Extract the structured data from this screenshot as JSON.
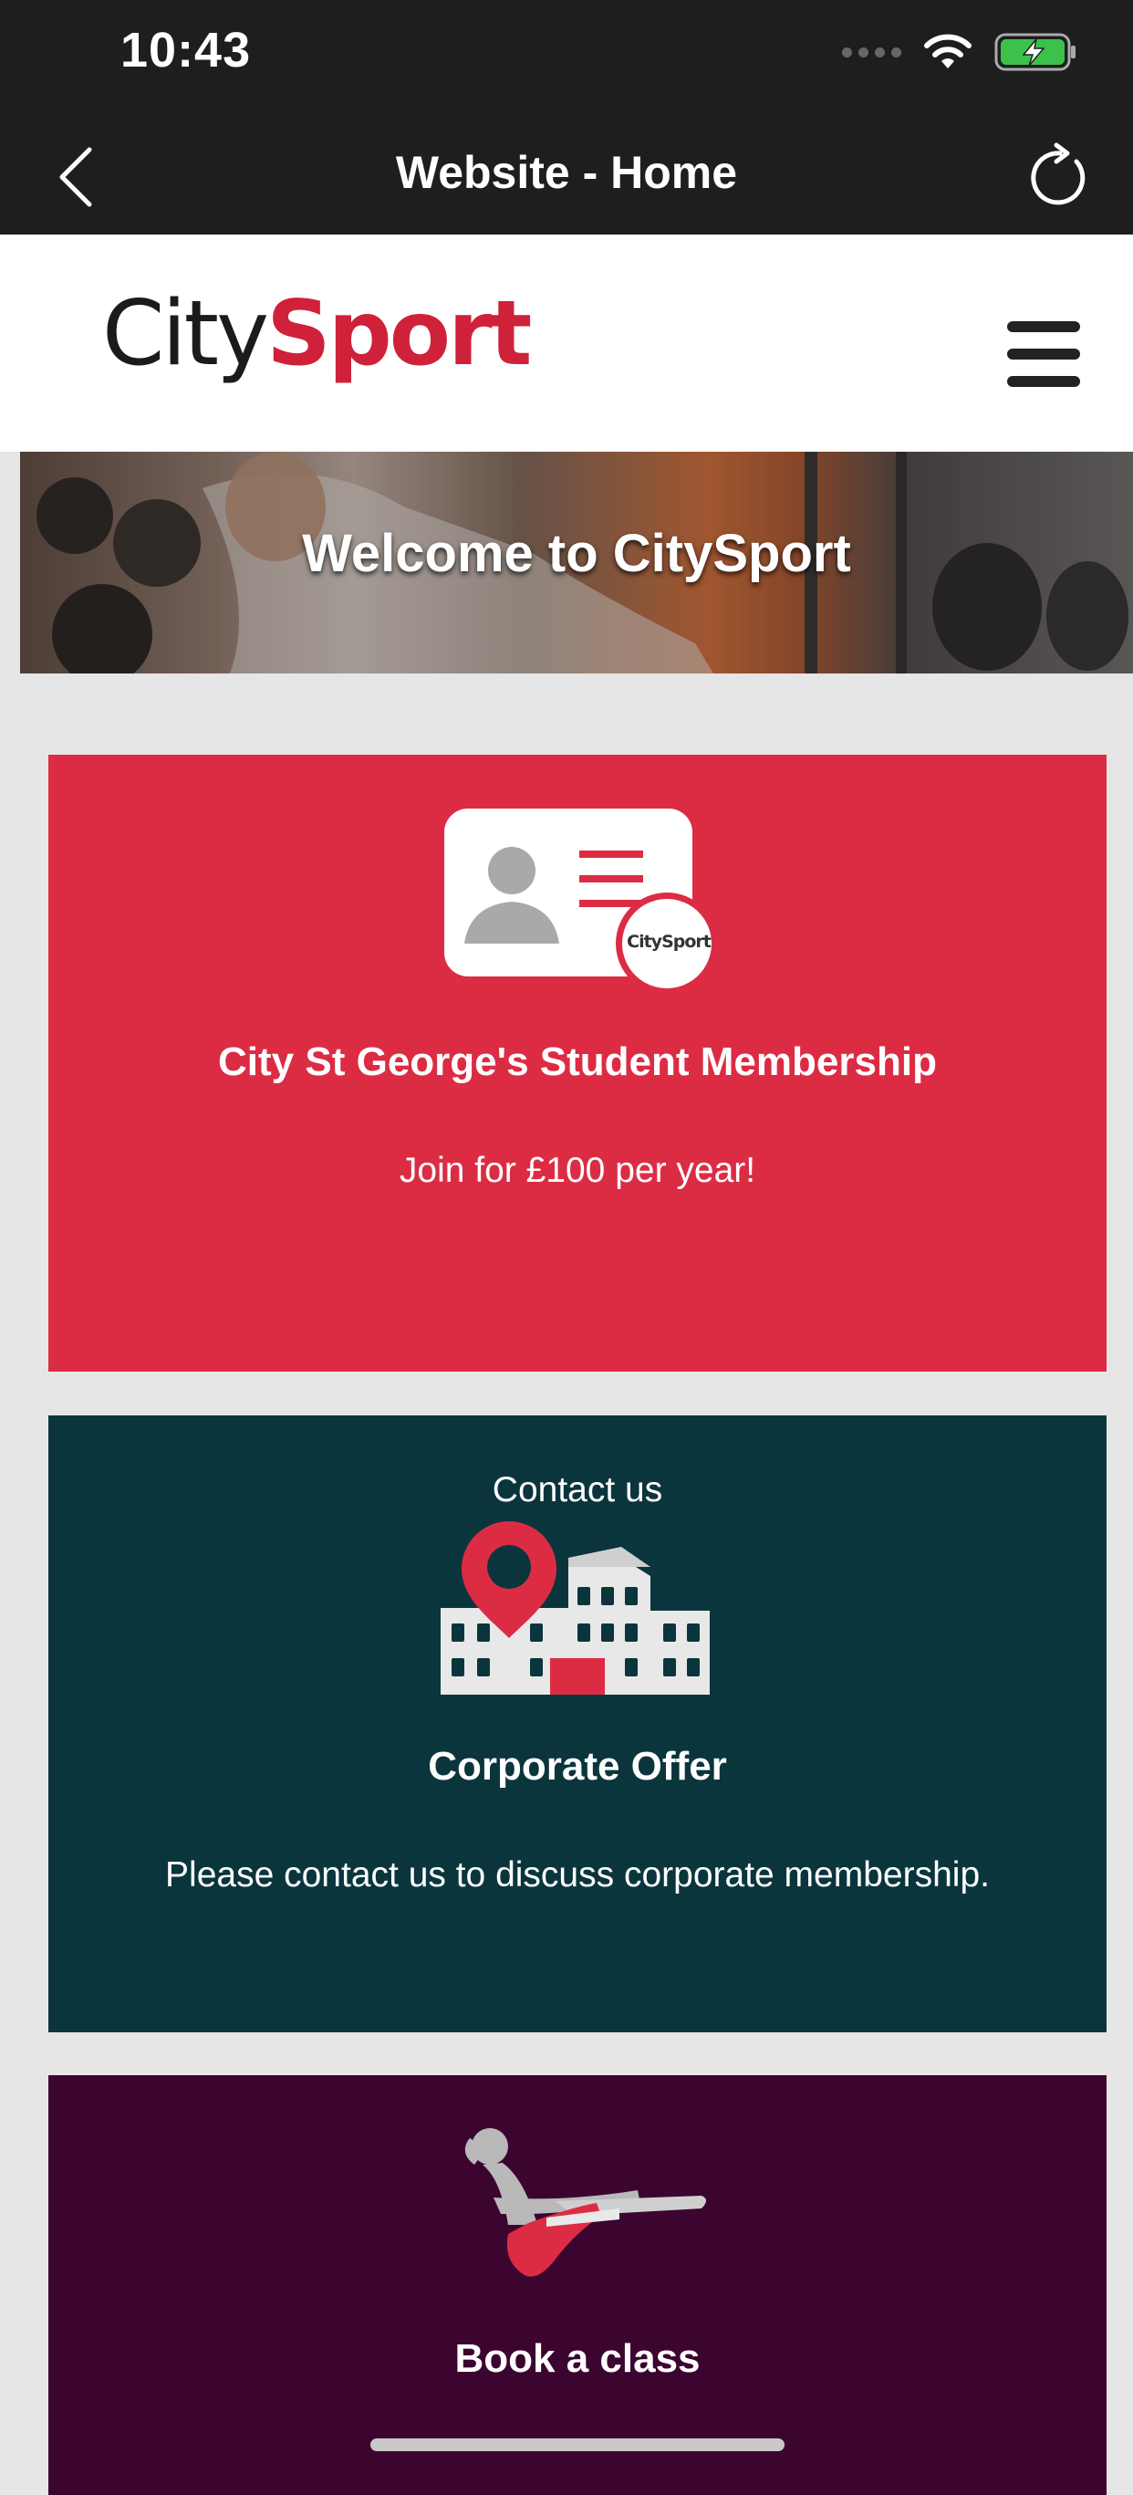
{
  "status_bar": {
    "time": "10:43"
  },
  "nav": {
    "title": "Website - Home"
  },
  "logo": {
    "city": "City",
    "sport": "Sport"
  },
  "hero": {
    "title": "Welcome to CitySport"
  },
  "cards": [
    {
      "title": "City St George's Student Membership",
      "text": "Join for £100 per year!",
      "icon": "membership-card-icon",
      "badge": "CitySport",
      "color": "#dc2c44"
    },
    {
      "top_text": "Contact us",
      "title": "Corporate Offer",
      "text": "Please contact us to discuss corporate membership.",
      "icon": "building-location-icon",
      "color": "#0b353d"
    },
    {
      "title": "Book a class",
      "icon": "pilates-figure-icon",
      "color": "#3c0530"
    }
  ],
  "colors": {
    "brand_red": "#d0213a",
    "bar_bg": "#1e1e1e",
    "page_bg": "#e6e6e6"
  }
}
